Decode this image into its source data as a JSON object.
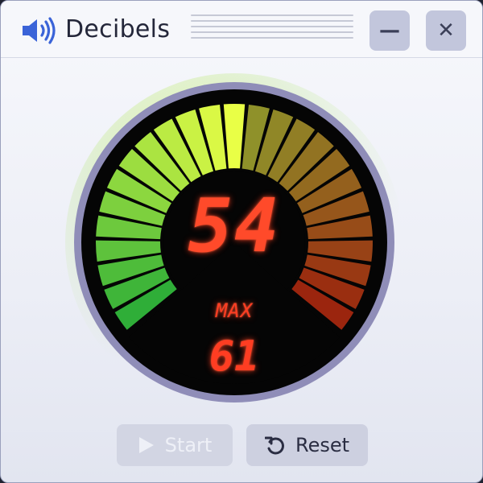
{
  "window": {
    "title": "Decibels",
    "minimize_glyph": "—",
    "close_glyph": "✕"
  },
  "icons": {
    "app": "speaker-icon",
    "minimize": "minimize-icon",
    "close": "close-icon",
    "start": "play-icon",
    "reset": "reset-icon"
  },
  "meter": {
    "current_db": "54",
    "max_label": "MAX",
    "max_db": "61",
    "segments_total": 25,
    "segments_lit": 13,
    "colors": {
      "low": "#2fae38",
      "mid": "#e9ff46",
      "high": "#ff3a14",
      "readout": "#ff4a2a",
      "ring": "#8f8db8"
    }
  },
  "controls": {
    "start_label": "Start",
    "reset_label": "Reset",
    "start_enabled": false
  }
}
